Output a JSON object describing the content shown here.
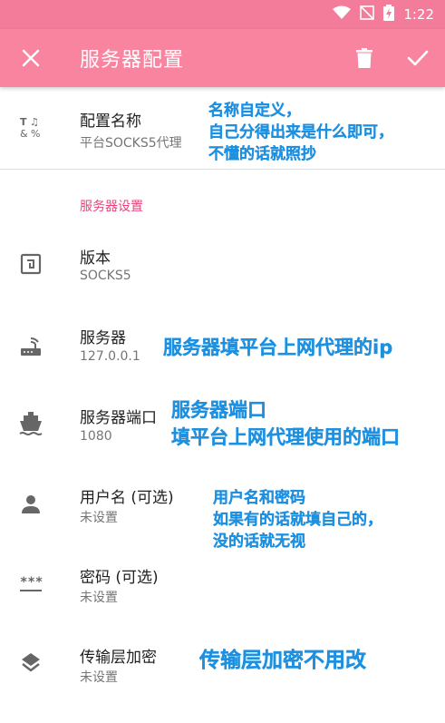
{
  "status": {
    "time": "1:22"
  },
  "appbar": {
    "title": "服务器配置"
  },
  "profile": {
    "label": "配置名称",
    "value": "平台SOCKS5代理"
  },
  "section": {
    "title": "服务器设置"
  },
  "settings": [
    {
      "label": "版本",
      "value": "SOCKS5"
    },
    {
      "label": "服务器",
      "value": "127.0.0.1"
    },
    {
      "label": "服务器端口",
      "value": "1080"
    },
    {
      "label": "用户名 (可选)",
      "value": "未设置"
    },
    {
      "label": "密码 (可选)",
      "value": "未设置"
    },
    {
      "label": "传输层加密",
      "value": "未设置"
    }
  ],
  "notes": {
    "profile": [
      "名称自定义，",
      "自己分得出来是什么即可，",
      "不懂的话就照抄"
    ],
    "server": "服务器填平台上网代理的ip",
    "port": [
      "服务器端口",
      "填平台上网代理使用的端口"
    ],
    "user": [
      "用户名和密码",
      "如果有的话就填自己的，",
      "没的话就无视"
    ],
    "tls": "传输层加密不用改"
  },
  "colors": {
    "appbar": "#f8849f",
    "statusbar": "#f27c9a",
    "accent": "#e8437a",
    "note": "#1e90e0"
  }
}
